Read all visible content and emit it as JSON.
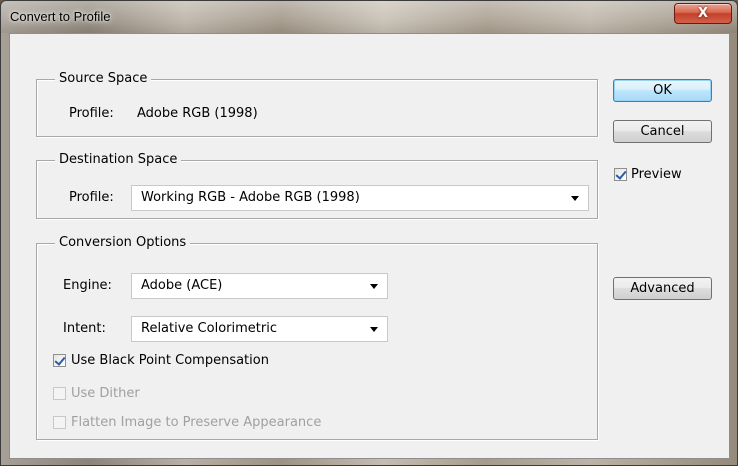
{
  "window": {
    "title": "Convert to Profile",
    "close_glyph": "X"
  },
  "source_space": {
    "legend": "Source Space",
    "profile_label": "Profile:",
    "profile_value": "Adobe RGB (1998)"
  },
  "destination_space": {
    "legend": "Destination Space",
    "profile_label": "Profile:",
    "profile_selected": "Working RGB - Adobe RGB (1998)"
  },
  "conversion_options": {
    "legend": "Conversion Options",
    "engine_label": "Engine:",
    "engine_selected": "Adobe (ACE)",
    "intent_label": "Intent:",
    "intent_selected": "Relative Colorimetric",
    "black_point": {
      "label": "Use Black Point Compensation",
      "checked": true,
      "enabled": true
    },
    "dither": {
      "label": "Use Dither",
      "checked": false,
      "enabled": false
    },
    "flatten": {
      "label": "Flatten Image to Preserve Appearance",
      "checked": false,
      "enabled": false
    }
  },
  "buttons": {
    "ok": "OK",
    "cancel": "Cancel",
    "advanced": "Advanced"
  },
  "preview": {
    "label": "Preview",
    "checked": true
  },
  "colors": {
    "dialog_bg": "#f0f0f0",
    "default_button_border": "#3c7fb1",
    "close_button": "#c4402a",
    "check_mark": "#2a5ba8",
    "disabled_text": "#a0a0a0"
  }
}
